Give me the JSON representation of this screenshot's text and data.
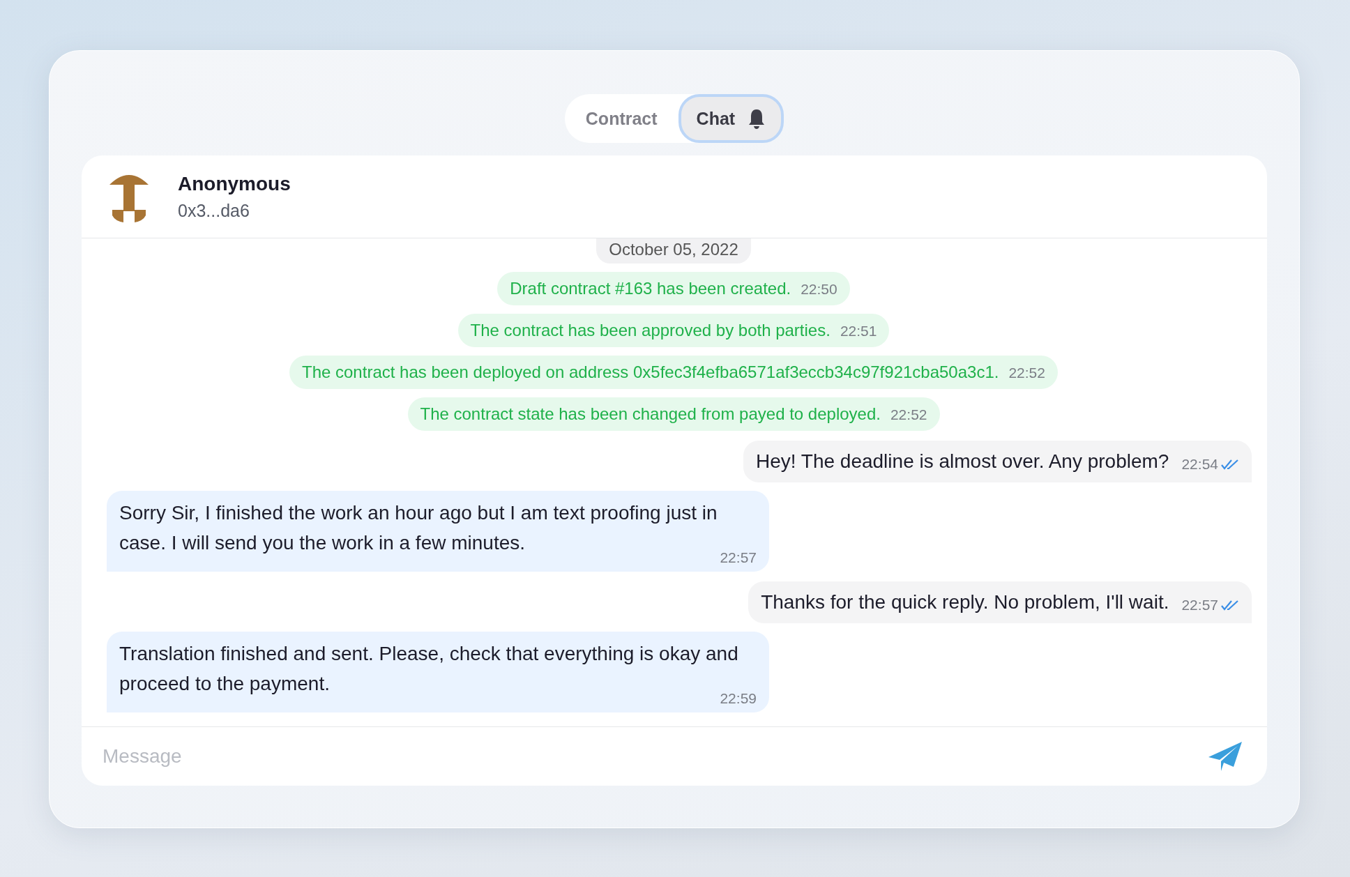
{
  "tabs": [
    {
      "label": "Contract",
      "selected": false,
      "bell": false
    },
    {
      "label": "Chat",
      "selected": true,
      "bell": true
    }
  ],
  "contact": {
    "name": "Anonymous",
    "address": "0x3...da6"
  },
  "date": "October 05, 2022",
  "messages": [
    {
      "kind": "system",
      "text": "Draft contract #163 has been created.",
      "time": "22:50"
    },
    {
      "kind": "system",
      "text": "The contract has been approved by both parties.",
      "time": "22:51"
    },
    {
      "kind": "system",
      "text": "The contract has been deployed on address 0x5fec3f4efba6571af3eccb34c97f921cba50a3c1.",
      "time": "22:52"
    },
    {
      "kind": "system",
      "text": "The contract state has been changed from payed to deployed.",
      "time": "22:52"
    },
    {
      "kind": "outgoing",
      "text": "Hey! The deadline is almost over. Any problem?",
      "time": "22:54",
      "read": true
    },
    {
      "kind": "incoming",
      "text": "Sorry Sir, I finished the work an hour ago but I am text proofing just in case. I will send you the work in a few minutes.",
      "time": "22:57"
    },
    {
      "kind": "outgoing",
      "text": "Thanks for the quick reply. No problem, I'll wait.",
      "time": "22:57",
      "read": true
    },
    {
      "kind": "incoming",
      "text": "Translation finished and sent. Please, check that everything is okay and proceed to the payment.",
      "time": "22:59"
    }
  ],
  "composer": {
    "placeholder": "Message"
  }
}
